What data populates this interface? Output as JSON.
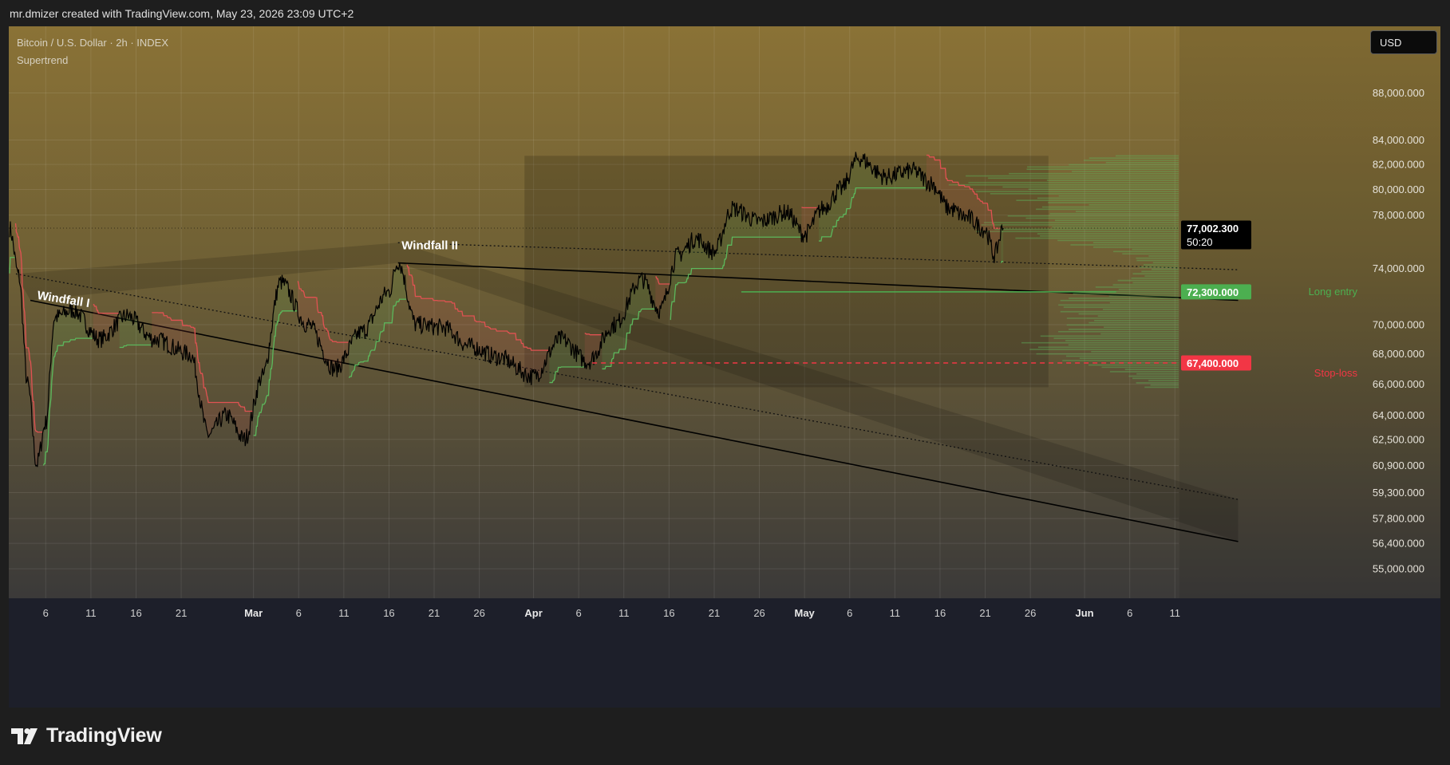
{
  "header": {
    "caption": "mr.dmizer created with TradingView.com, May 23, 2026 23:09 UTC+2"
  },
  "legend": {
    "symbol": "Bitcoin / U.S. Dollar · 2h · INDEX",
    "indicator": "Supertrend"
  },
  "currency_button": "USD",
  "brand": {
    "name": "TradingView",
    "icon": "tradingview-logo-icon"
  },
  "colors": {
    "up": "#5cb85c",
    "down": "#e05252",
    "candle": "#000000",
    "long_entry": "#4caf50",
    "stop_loss": "#f23645",
    "current_price_bg": "#000000"
  },
  "chart_data": {
    "type": "line",
    "title": "Bitcoin / U.S. Dollar · 2h · INDEX",
    "xlabel": "",
    "ylabel": "",
    "scale": "log",
    "ylim": [
      54200,
      95000
    ],
    "x_ticks": [
      "6",
      "11",
      "16",
      "21",
      "Mar",
      "6",
      "11",
      "16",
      "21",
      "26",
      "Apr",
      "6",
      "11",
      "16",
      "21",
      "26",
      "May",
      "6",
      "11",
      "16",
      "21",
      "26",
      "Jun",
      "6",
      "11"
    ],
    "y_ticks": [
      "88,000.000",
      "84,000.000",
      "82,000.000",
      "80,000.000",
      "78,000.000",
      "74,000.000",
      "70,000.000",
      "68,000.000",
      "66,000.000",
      "64,000.000",
      "62,500.000",
      "60,900.000",
      "59,300.000",
      "57,800.000",
      "56,400.000",
      "55,000.000"
    ],
    "price_path": {
      "x_dates": [
        "Feb 2",
        "Feb 3",
        "Feb 4",
        "Feb 5",
        "Feb 6",
        "Feb 7",
        "Feb 9",
        "Feb 12",
        "Feb 15",
        "Feb 18",
        "Feb 22",
        "Feb 24",
        "Feb 26",
        "Feb 28",
        "Mar 2",
        "Mar 4",
        "Mar 7",
        "Mar 10",
        "Mar 13",
        "Mar 16",
        "Mar 17",
        "Mar 19",
        "Mar 22",
        "Mar 25",
        "Mar 28",
        "Apr 1",
        "Apr 4",
        "Apr 7",
        "Apr 10",
        "Apr 13",
        "Apr 15",
        "Apr 17",
        "Apr 19",
        "Apr 21",
        "Apr 23",
        "Apr 26",
        "Apr 29",
        "May 1",
        "May 3",
        "May 5",
        "May 7",
        "May 10",
        "May 13",
        "May 15",
        "May 17",
        "May 19",
        "May 21",
        "May 22",
        "May 23"
      ],
      "y_values": [
        77000,
        73500,
        66000,
        61000,
        63500,
        70500,
        71000,
        69000,
        70600,
        69000,
        68000,
        62800,
        64000,
        62500,
        66500,
        73000,
        70000,
        67000,
        69500,
        72300,
        74500,
        70000,
        69800,
        68500,
        67800,
        66500,
        69000,
        67500,
        70000,
        73200,
        71000,
        75000,
        76200,
        75200,
        78500,
        77500,
        78200,
        76500,
        78500,
        80000,
        82500,
        81000,
        81500,
        80500,
        78500,
        77800,
        76900,
        75000,
        77000
      ]
    },
    "supertrend": "stepped trailing line, green below price in uptrends and red above price in downtrends",
    "annotations": [
      {
        "label": "Windfall I"
      },
      {
        "label": "Windfall II"
      },
      {
        "label": "Long entry",
        "value": 72300,
        "tag": "72,300.000"
      },
      {
        "label": "Stop-loss",
        "value": 67400,
        "tag": "67,400.000"
      }
    ],
    "current_price": {
      "value": 77002.3,
      "tag": "77,002.300",
      "countdown": "50:20"
    },
    "volume_profile": "horizontal green histogram anchored at the right edge, range 65,800 to 82,700",
    "grid": true
  }
}
